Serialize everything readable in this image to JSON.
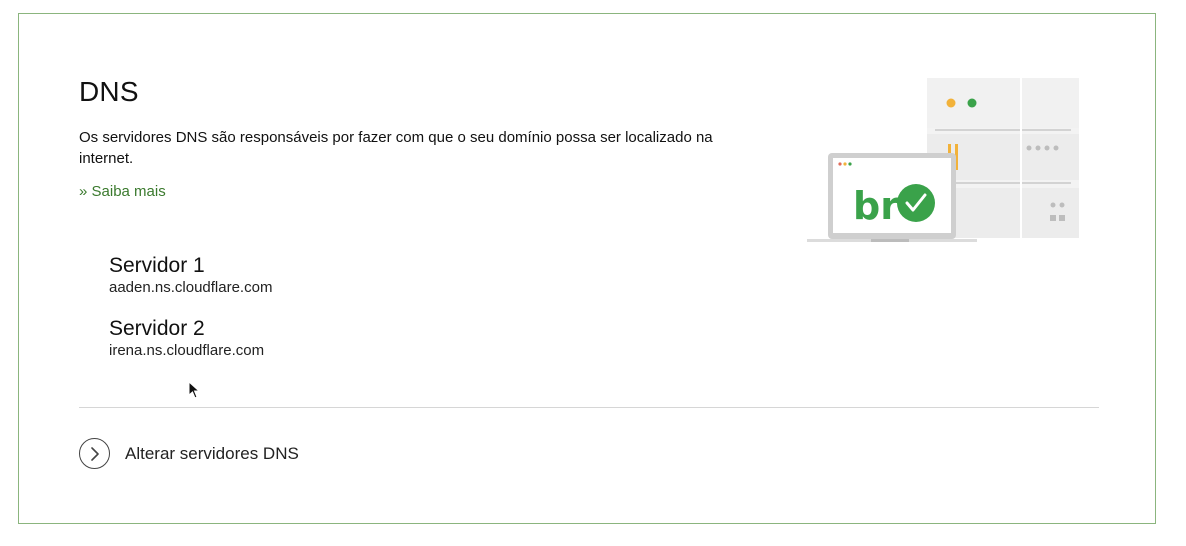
{
  "dns": {
    "title": "DNS",
    "description": "Os servidores DNS são responsáveis por fazer com que o seu domínio possa ser localizado na internet.",
    "learn_more": "» Saiba mais"
  },
  "servers": [
    {
      "name": "Servidor 1",
      "host": "aaden.ns.cloudflare.com"
    },
    {
      "name": "Servidor 2",
      "host": "irena.ns.cloudflare.com"
    }
  ],
  "action": {
    "label": "Alterar servidores DNS",
    "icon": "chevron-right-icon"
  },
  "illustration": {
    "icon": "br-domain-server-illustration",
    "logo_text": "br"
  },
  "colors": {
    "border": "#8bb57e",
    "link": "#3b7a2e",
    "check_green": "#3aa24a",
    "accent_yellow": "#f2b23a"
  }
}
